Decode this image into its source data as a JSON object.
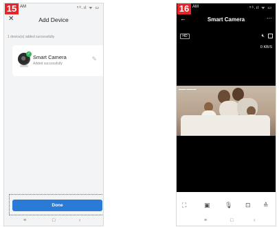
{
  "left_phone": {
    "step": "15",
    "status_time": "AM",
    "status_icons": "⁵⁶.ıl ᯤ ▭",
    "header": {
      "title": "Add Device",
      "close_icon": "close-icon"
    },
    "subtext": "1 device(s) added successfully",
    "device_card": {
      "name": "Smart Camera",
      "status": "Added successfully",
      "edit_icon": "pencil-icon"
    },
    "done_button": "Done",
    "nav": {
      "menu": "≡",
      "home": "□",
      "back": "‹"
    }
  },
  "right_phone": {
    "step": "16",
    "status_time": "AM",
    "status_icons": "⁵⁶.ıl ᯤ ▭",
    "header": {
      "title": "Smart Camera",
      "back_icon": "back-arrow-icon",
      "more_icon": "more-icon"
    },
    "video": {
      "quality": "HD",
      "rate": "0 KB/S"
    },
    "controls": [
      "fullscreen-icon",
      "screenshot-icon",
      "microphone-icon",
      "record-icon",
      "expand-up-icon"
    ],
    "nav": {
      "menu": "≡",
      "home": "□",
      "back": "‹"
    }
  },
  "colors": {
    "step_badge": "#e4262b",
    "done_button": "#2a7bd6",
    "success_check": "#35b65a",
    "highlight_outline": "#e4262b"
  }
}
